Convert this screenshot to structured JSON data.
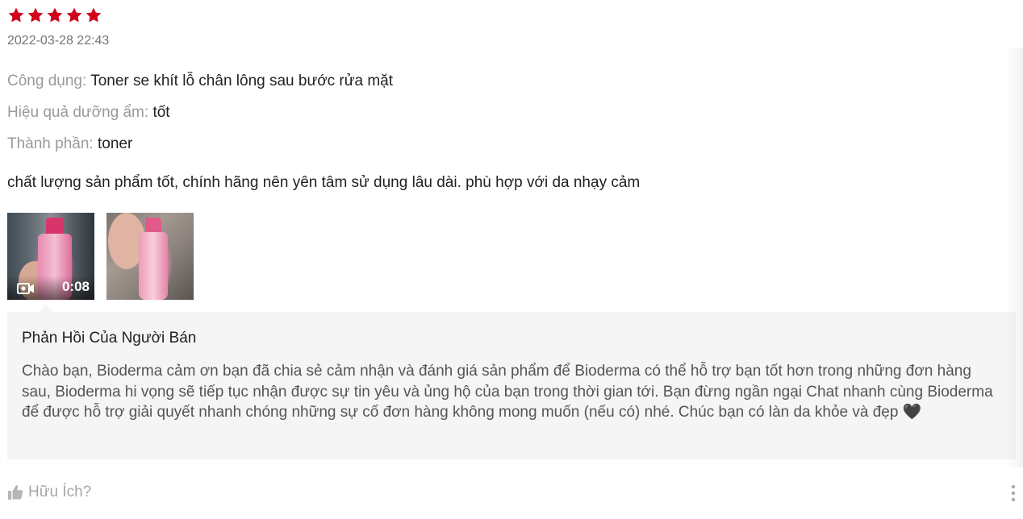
{
  "review": {
    "rating": 5,
    "max_rating": 5,
    "star_color": "#d0011b",
    "timestamp": "2022-03-28 22:43",
    "attributes": [
      {
        "label": "Công dụng:",
        "value": "Toner se khít lỗ chân lông sau bước rửa mặt"
      },
      {
        "label": "Hiệu quả dưỡng ẩm:",
        "value": "tốt"
      },
      {
        "label": "Thành phần:",
        "value": "toner"
      }
    ],
    "comment": "chất lượng sản phẩm tốt, chính hãng nên yên tâm sử dụng lâu dài. phù hợp với da nhạy cảm",
    "media": [
      {
        "type": "video",
        "duration": "0:08",
        "icon": "video-camera-icon"
      },
      {
        "type": "image"
      }
    ]
  },
  "seller_reply": {
    "title": "Phản Hồi Của Người Bán",
    "body": "Chào bạn, Bioderma cảm ơn bạn đã chia sẻ cảm nhận và đánh giá sản phẩm để Bioderma có thể hỗ trợ bạn tốt hơn trong những đơn hàng sau, Bioderma hi vọng sẽ tiếp tục nhận được sự tin yêu và ủng hộ của bạn trong thời gian tới. Bạn đừng ngần ngại Chat nhanh cùng Bioderma để được hỗ trợ giải quyết nhanh chóng những sự cố đơn hàng không mong muốn (nếu có) nhé. Chúc bạn có làn da khỏe và đẹp 🖤",
    "background_color": "#f5f5f5"
  },
  "footer": {
    "helpful_label": "Hữu Ích?",
    "helpful_icon": "thumbs-up-icon",
    "more_icon": "more-vertical-icon"
  }
}
